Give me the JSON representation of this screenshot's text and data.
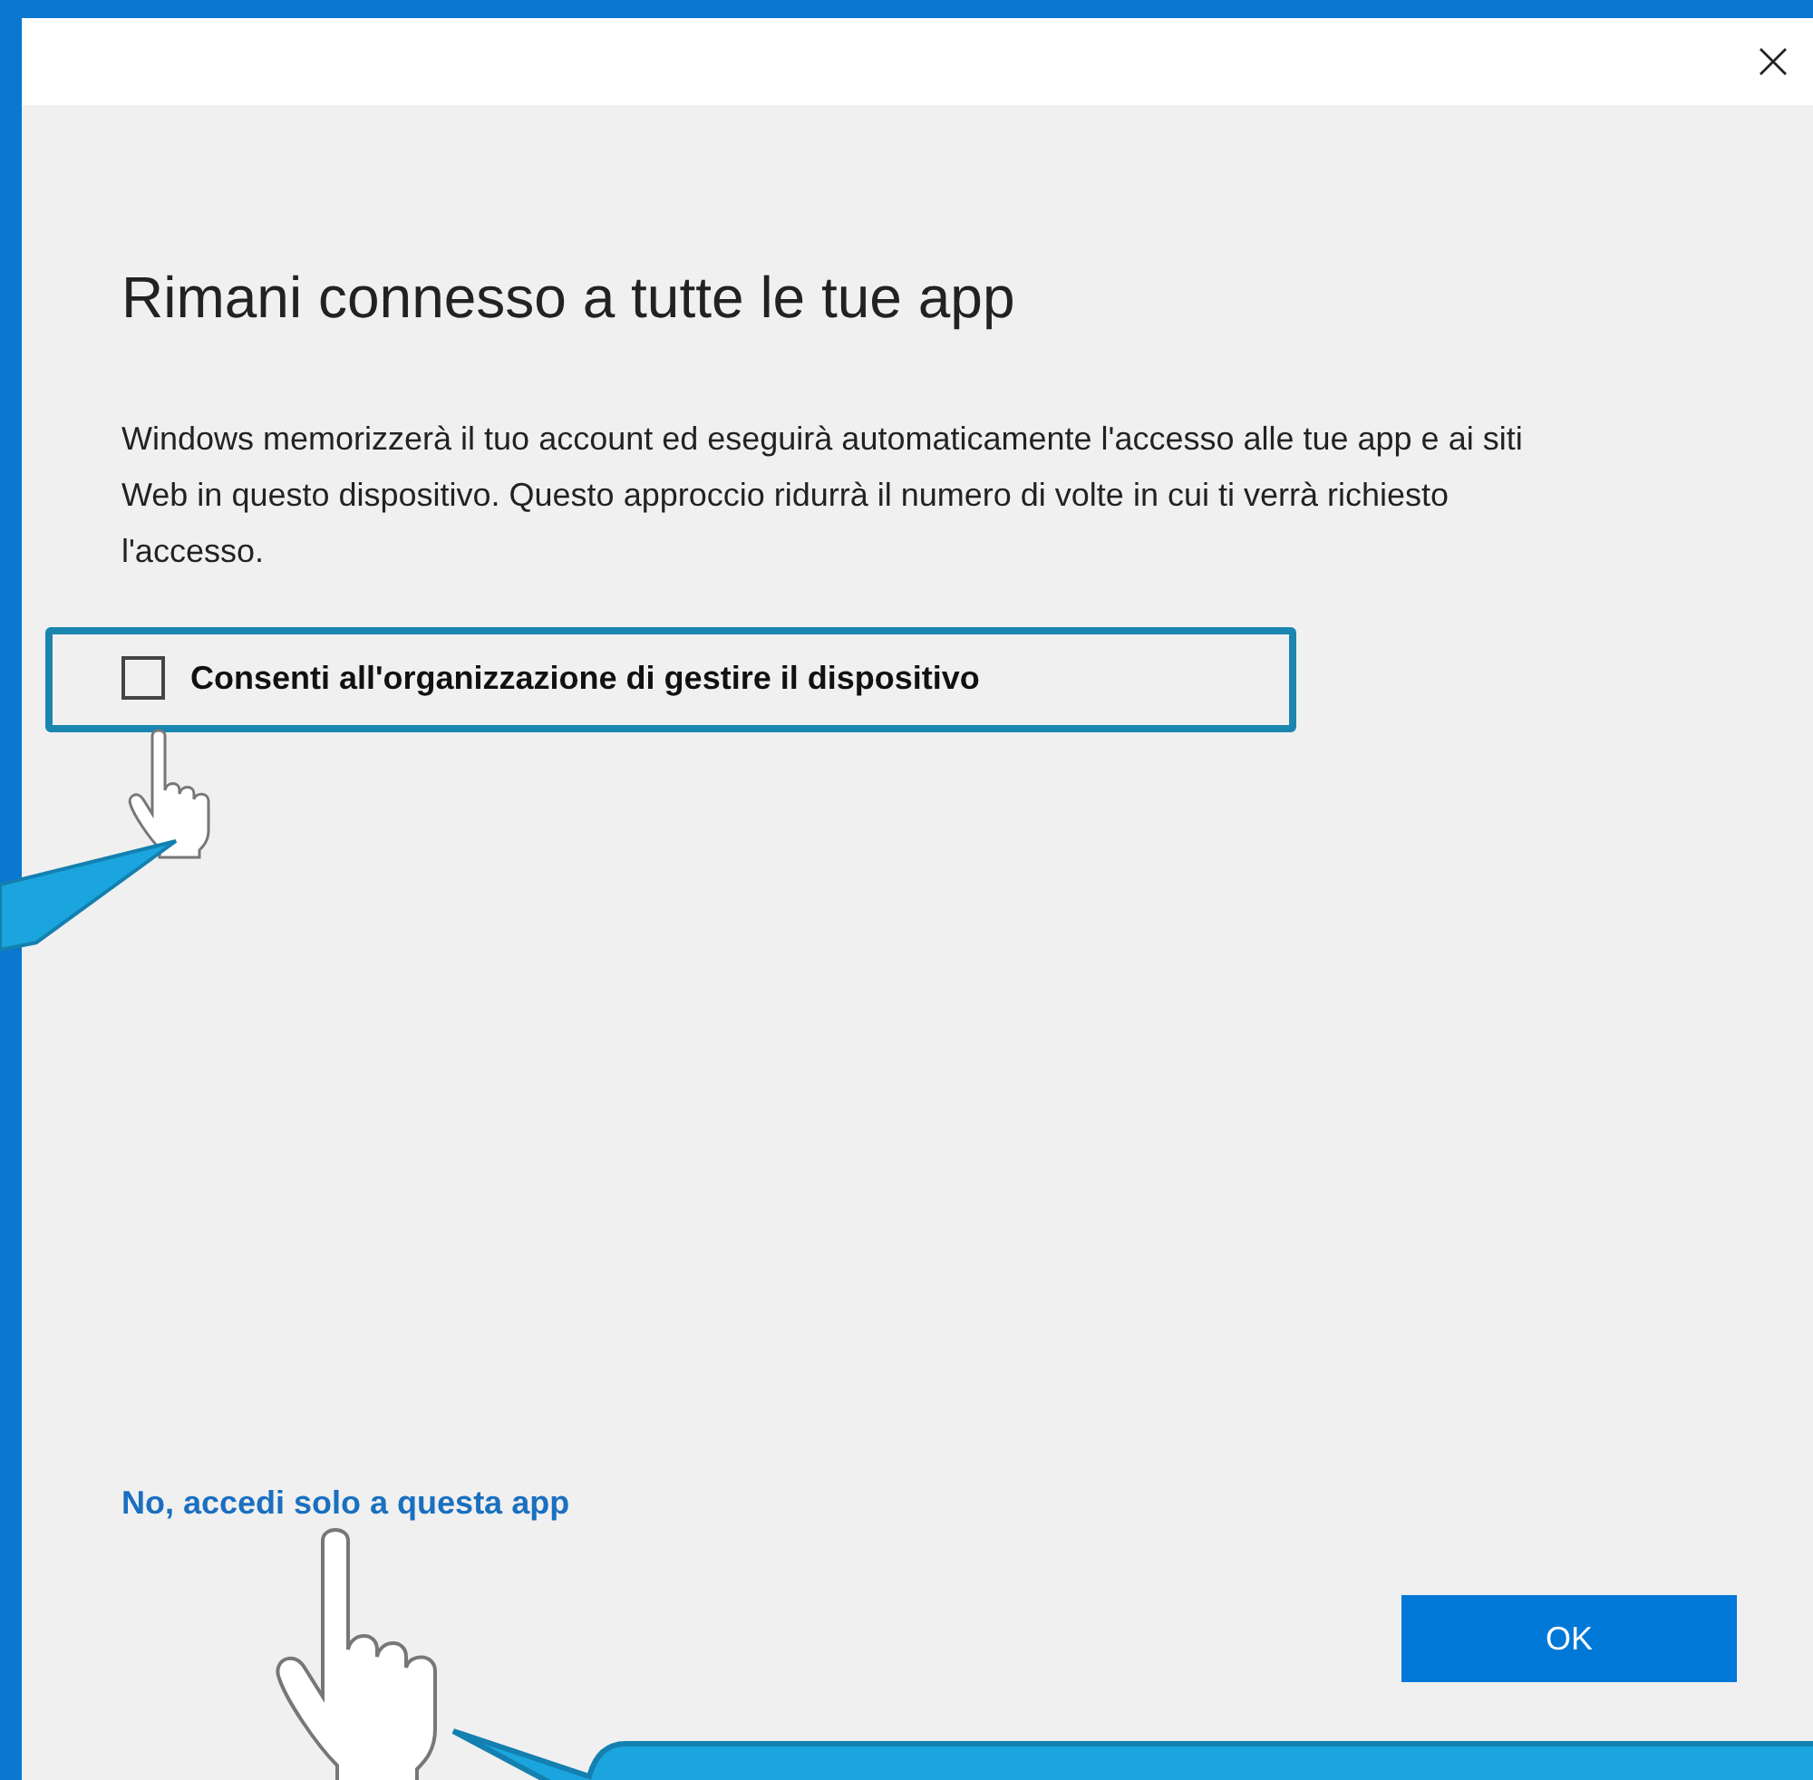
{
  "dialog": {
    "heading": "Rimani connesso a tutte le tue app",
    "description": "Windows memorizzerà il tuo account ed eseguirà automaticamente l'accesso alle tue app e ai siti Web in questo dispositivo. Questo approccio ridurrà il numero di volte in cui ti verrà richiesto l'accesso.",
    "checkbox": {
      "label": "Consenti all'organizzazione di gestire il dispositivo",
      "checked": false
    },
    "link": "No, accedi solo a questa app",
    "buttons": [
      "OK"
    ]
  }
}
